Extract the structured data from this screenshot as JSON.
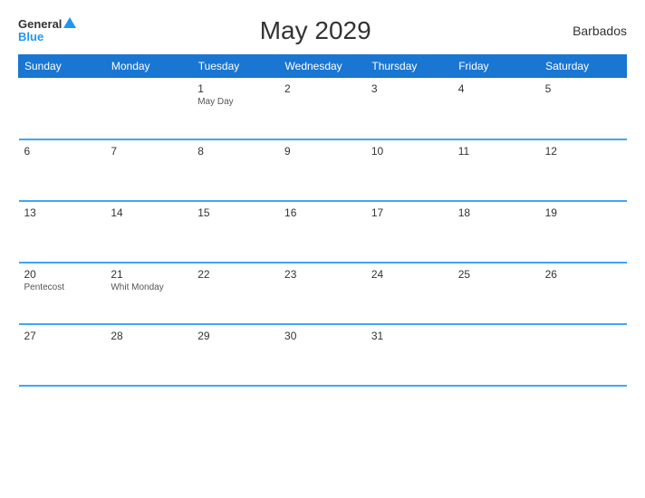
{
  "header": {
    "logo_general": "General",
    "logo_blue": "Blue",
    "title": "May 2029",
    "country": "Barbados"
  },
  "days_of_week": [
    "Sunday",
    "Monday",
    "Tuesday",
    "Wednesday",
    "Thursday",
    "Friday",
    "Saturday"
  ],
  "weeks": [
    [
      {
        "day": "",
        "holiday": ""
      },
      {
        "day": "",
        "holiday": ""
      },
      {
        "day": "1",
        "holiday": "May Day"
      },
      {
        "day": "2",
        "holiday": ""
      },
      {
        "day": "3",
        "holiday": ""
      },
      {
        "day": "4",
        "holiday": ""
      },
      {
        "day": "5",
        "holiday": ""
      }
    ],
    [
      {
        "day": "6",
        "holiday": ""
      },
      {
        "day": "7",
        "holiday": ""
      },
      {
        "day": "8",
        "holiday": ""
      },
      {
        "day": "9",
        "holiday": ""
      },
      {
        "day": "10",
        "holiday": ""
      },
      {
        "day": "11",
        "holiday": ""
      },
      {
        "day": "12",
        "holiday": ""
      }
    ],
    [
      {
        "day": "13",
        "holiday": ""
      },
      {
        "day": "14",
        "holiday": ""
      },
      {
        "day": "15",
        "holiday": ""
      },
      {
        "day": "16",
        "holiday": ""
      },
      {
        "day": "17",
        "holiday": ""
      },
      {
        "day": "18",
        "holiday": ""
      },
      {
        "day": "19",
        "holiday": ""
      }
    ],
    [
      {
        "day": "20",
        "holiday": "Pentecost"
      },
      {
        "day": "21",
        "holiday": "Whit Monday"
      },
      {
        "day": "22",
        "holiday": ""
      },
      {
        "day": "23",
        "holiday": ""
      },
      {
        "day": "24",
        "holiday": ""
      },
      {
        "day": "25",
        "holiday": ""
      },
      {
        "day": "26",
        "holiday": ""
      }
    ],
    [
      {
        "day": "27",
        "holiday": ""
      },
      {
        "day": "28",
        "holiday": ""
      },
      {
        "day": "29",
        "holiday": ""
      },
      {
        "day": "30",
        "holiday": ""
      },
      {
        "day": "31",
        "holiday": ""
      },
      {
        "day": "",
        "holiday": ""
      },
      {
        "day": "",
        "holiday": ""
      }
    ]
  ]
}
